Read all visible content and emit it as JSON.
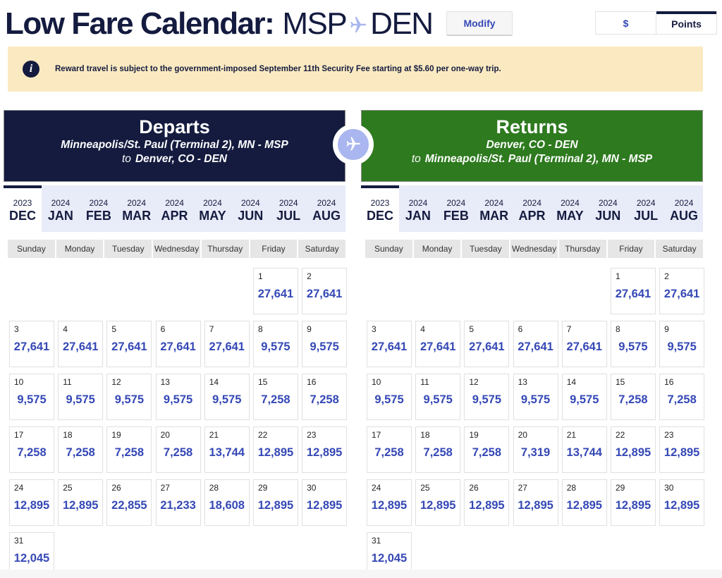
{
  "header": {
    "title_main": "Low Fare Calendar:",
    "origin": "MSP",
    "destination": "DEN",
    "route_icon": "plane-icon",
    "modify_label": "Modify",
    "currency_toggle": {
      "options": [
        "$",
        "Points"
      ],
      "selected": "Points"
    }
  },
  "notice": {
    "icon": "info-icon",
    "text": "Reward travel is subject to the government-imposed September 11th Security Fee starting at $5.60 per one-way trip."
  },
  "colors": {
    "navy": "#141b3f",
    "green": "#2e7a1f",
    "price_blue": "#3548b5",
    "notice_bg": "#fbeac1",
    "month_tab_bg": "#e8ebf8",
    "plane_circle": "#a9b6ef"
  },
  "center_icon": "plane-icon",
  "departs": {
    "title": "Departs",
    "from": "Minneapolis/St. Paul (Terminal 2), MN - MSP",
    "to_word": "to",
    "to": "Denver, CO - DEN",
    "months": [
      {
        "year": "2023",
        "month": "DEC",
        "active": true
      },
      {
        "year": "2024",
        "month": "JAN"
      },
      {
        "year": "2024",
        "month": "FEB"
      },
      {
        "year": "2024",
        "month": "MAR"
      },
      {
        "year": "2024",
        "month": "APR"
      },
      {
        "year": "2024",
        "month": "MAY"
      },
      {
        "year": "2024",
        "month": "JUN"
      },
      {
        "year": "2024",
        "month": "JUL"
      },
      {
        "year": "2024",
        "month": "AUG"
      }
    ],
    "weekdays": [
      "Sunday",
      "Monday",
      "Tuesday",
      "Wednesday",
      "Thursday",
      "Friday",
      "Saturday"
    ],
    "first_weekday_index": 5,
    "days": [
      {
        "day": "1",
        "price": "27,641"
      },
      {
        "day": "2",
        "price": "27,641"
      },
      {
        "day": "3",
        "price": "27,641"
      },
      {
        "day": "4",
        "price": "27,641"
      },
      {
        "day": "5",
        "price": "27,641"
      },
      {
        "day": "6",
        "price": "27,641"
      },
      {
        "day": "7",
        "price": "27,641"
      },
      {
        "day": "8",
        "price": "9,575"
      },
      {
        "day": "9",
        "price": "9,575"
      },
      {
        "day": "10",
        "price": "9,575"
      },
      {
        "day": "11",
        "price": "9,575"
      },
      {
        "day": "12",
        "price": "9,575"
      },
      {
        "day": "13",
        "price": "9,575"
      },
      {
        "day": "14",
        "price": "9,575"
      },
      {
        "day": "15",
        "price": "7,258"
      },
      {
        "day": "16",
        "price": "7,258"
      },
      {
        "day": "17",
        "price": "7,258"
      },
      {
        "day": "18",
        "price": "7,258"
      },
      {
        "day": "19",
        "price": "7,258"
      },
      {
        "day": "20",
        "price": "7,258"
      },
      {
        "day": "21",
        "price": "13,744"
      },
      {
        "day": "22",
        "price": "12,895"
      },
      {
        "day": "23",
        "price": "12,895"
      },
      {
        "day": "24",
        "price": "12,895"
      },
      {
        "day": "25",
        "price": "12,895"
      },
      {
        "day": "26",
        "price": "22,855"
      },
      {
        "day": "27",
        "price": "21,233"
      },
      {
        "day": "28",
        "price": "18,608"
      },
      {
        "day": "29",
        "price": "12,895"
      },
      {
        "day": "30",
        "price": "12,895"
      },
      {
        "day": "31",
        "price": "12,045"
      }
    ]
  },
  "returns": {
    "title": "Returns",
    "from": "Denver, CO - DEN",
    "to_word": "to",
    "to": "Minneapolis/St. Paul (Terminal 2), MN - MSP",
    "months": [
      {
        "year": "2023",
        "month": "DEC",
        "active": true
      },
      {
        "year": "2024",
        "month": "JAN"
      },
      {
        "year": "2024",
        "month": "FEB"
      },
      {
        "year": "2024",
        "month": "MAR"
      },
      {
        "year": "2024",
        "month": "APR"
      },
      {
        "year": "2024",
        "month": "MAY"
      },
      {
        "year": "2024",
        "month": "JUN"
      },
      {
        "year": "2024",
        "month": "JUL"
      },
      {
        "year": "2024",
        "month": "AUG"
      }
    ],
    "weekdays": [
      "Sunday",
      "Monday",
      "Tuesday",
      "Wednesday",
      "Thursday",
      "Friday",
      "Saturday"
    ],
    "first_weekday_index": 5,
    "days": [
      {
        "day": "1",
        "price": "27,641"
      },
      {
        "day": "2",
        "price": "27,641"
      },
      {
        "day": "3",
        "price": "27,641"
      },
      {
        "day": "4",
        "price": "27,641"
      },
      {
        "day": "5",
        "price": "27,641"
      },
      {
        "day": "6",
        "price": "27,641"
      },
      {
        "day": "7",
        "price": "27,641"
      },
      {
        "day": "8",
        "price": "9,575"
      },
      {
        "day": "9",
        "price": "9,575"
      },
      {
        "day": "10",
        "price": "9,575"
      },
      {
        "day": "11",
        "price": "9,575"
      },
      {
        "day": "12",
        "price": "9,575"
      },
      {
        "day": "13",
        "price": "9,575"
      },
      {
        "day": "14",
        "price": "9,575"
      },
      {
        "day": "15",
        "price": "7,258"
      },
      {
        "day": "16",
        "price": "7,258"
      },
      {
        "day": "17",
        "price": "7,258"
      },
      {
        "day": "18",
        "price": "7,258"
      },
      {
        "day": "19",
        "price": "7,258"
      },
      {
        "day": "20",
        "price": "7,319"
      },
      {
        "day": "21",
        "price": "13,744"
      },
      {
        "day": "22",
        "price": "12,895"
      },
      {
        "day": "23",
        "price": "12,895"
      },
      {
        "day": "24",
        "price": "12,895"
      },
      {
        "day": "25",
        "price": "12,895"
      },
      {
        "day": "26",
        "price": "12,895"
      },
      {
        "day": "27",
        "price": "12,895"
      },
      {
        "day": "28",
        "price": "12,895"
      },
      {
        "day": "29",
        "price": "12,895"
      },
      {
        "day": "30",
        "price": "12,895"
      },
      {
        "day": "31",
        "price": "12,045"
      }
    ]
  }
}
